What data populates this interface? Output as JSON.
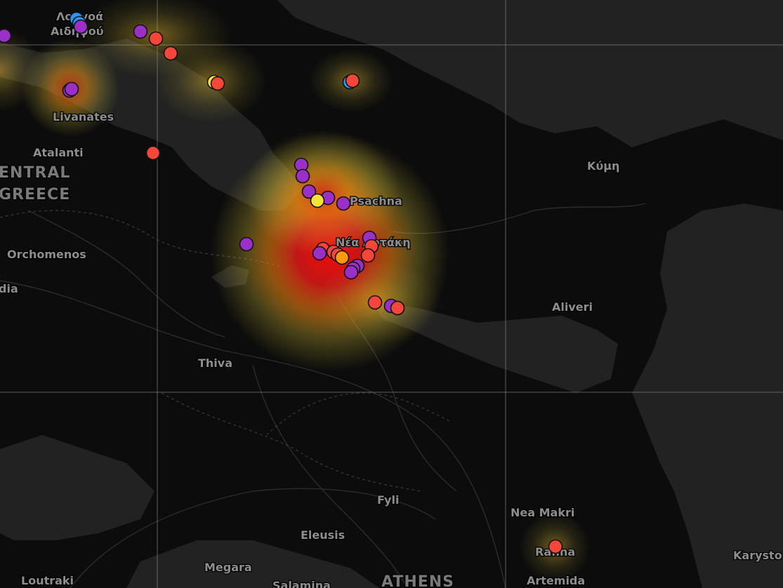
{
  "map": {
    "labels": [
      {
        "text": "Λογγοά",
        "kind": "town"
      },
      {
        "text": "Αιδηψού",
        "kind": "town"
      },
      {
        "text": "Livanates",
        "kind": "town"
      },
      {
        "text": "Atalanti",
        "kind": "town"
      },
      {
        "text": "ENTRAL",
        "kind": "region"
      },
      {
        "text": "GREECE",
        "kind": "region"
      },
      {
        "text": "Orchomenos",
        "kind": "town"
      },
      {
        "text": "dia",
        "kind": "town"
      },
      {
        "text": "Psachna",
        "kind": "town"
      },
      {
        "text": "Νέα Αρτάκη",
        "kind": "town"
      },
      {
        "text": "Κύμη",
        "kind": "town"
      },
      {
        "text": "Aliveri",
        "kind": "town"
      },
      {
        "text": "Thiva",
        "kind": "town"
      },
      {
        "text": "Fyli",
        "kind": "town"
      },
      {
        "text": "Nea Makri",
        "kind": "town"
      },
      {
        "text": "Rafina",
        "kind": "town"
      },
      {
        "text": "Eleusis",
        "kind": "town"
      },
      {
        "text": "Megara",
        "kind": "town"
      },
      {
        "text": "Loutraki",
        "kind": "town"
      },
      {
        "text": "Salamina",
        "kind": "town"
      },
      {
        "text": "ATHENS",
        "kind": "city"
      },
      {
        "text": "Artemida",
        "kind": "town"
      },
      {
        "text": "Karystos",
        "kind": "town"
      }
    ],
    "marker_colors": {
      "purple": "#9b30c8",
      "red": "#f4473a",
      "orange": "#ff9a0e",
      "yellow": "#f7e238",
      "blue": "#2f96ef"
    },
    "markers": [
      {
        "color": "purple"
      },
      {
        "color": "blue"
      },
      {
        "color": "blue"
      },
      {
        "color": "purple"
      },
      {
        "color": "purple"
      },
      {
        "color": "purple"
      },
      {
        "color": "red"
      },
      {
        "color": "red"
      },
      {
        "color": "red"
      },
      {
        "color": "yellow"
      },
      {
        "color": "red"
      },
      {
        "color": "purple"
      },
      {
        "color": "purple"
      },
      {
        "color": "red"
      },
      {
        "color": "blue"
      },
      {
        "color": "red"
      },
      {
        "color": "purple"
      },
      {
        "color": "purple"
      },
      {
        "color": "purple"
      },
      {
        "color": "purple"
      },
      {
        "color": "yellow"
      },
      {
        "color": "purple"
      },
      {
        "color": "purple"
      },
      {
        "color": "purple"
      },
      {
        "color": "red"
      },
      {
        "color": "red"
      },
      {
        "color": "red"
      },
      {
        "color": "purple"
      },
      {
        "color": "red"
      },
      {
        "color": "red"
      },
      {
        "color": "orange"
      },
      {
        "color": "purple"
      },
      {
        "color": "purple"
      },
      {
        "color": "purple"
      },
      {
        "color": "red"
      },
      {
        "color": "red"
      },
      {
        "color": "purple"
      },
      {
        "color": "red"
      },
      {
        "color": "red"
      }
    ],
    "heat_colors": [
      "#ff0000",
      "#ff8800",
      "#ffee44"
    ],
    "water_color": "#222222",
    "land_color": "#0c0c0c"
  }
}
